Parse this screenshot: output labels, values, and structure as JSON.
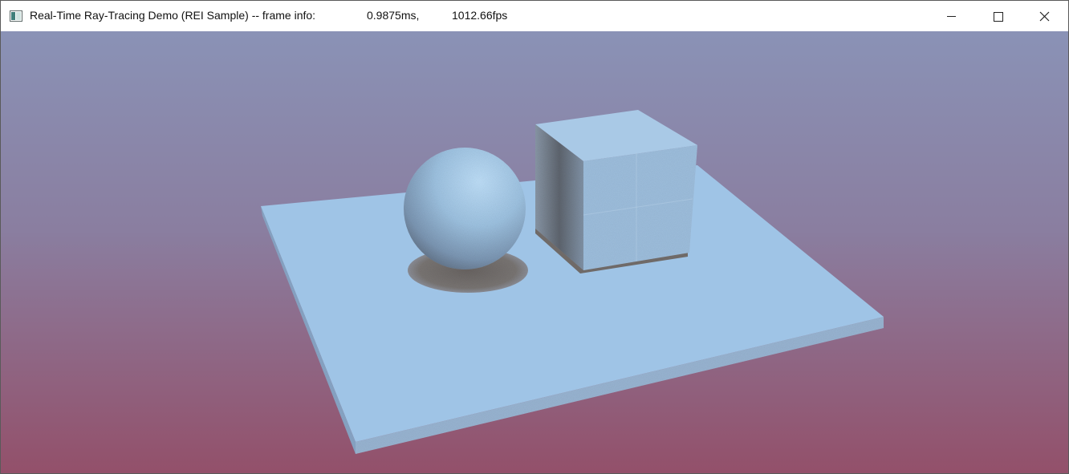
{
  "window": {
    "icon": "app-window-icon",
    "title": "Real-Time Ray-Tracing Demo (REI Sample) -- frame info:",
    "frame_time": "0.9875ms,",
    "frame_rate": "1012.66fps",
    "controls": {
      "minimize_icon": "minimize-icon",
      "maximize_icon": "maximize-icon",
      "close_icon": "close-icon"
    }
  },
  "scene": {
    "objects": [
      "ground-plane",
      "sphere",
      "cube"
    ],
    "colors": {
      "sky_top": "#8a90b5",
      "sky_bottom": "#92526a",
      "surface": "#9fc4e6",
      "shadow": "#6f6a68"
    }
  }
}
